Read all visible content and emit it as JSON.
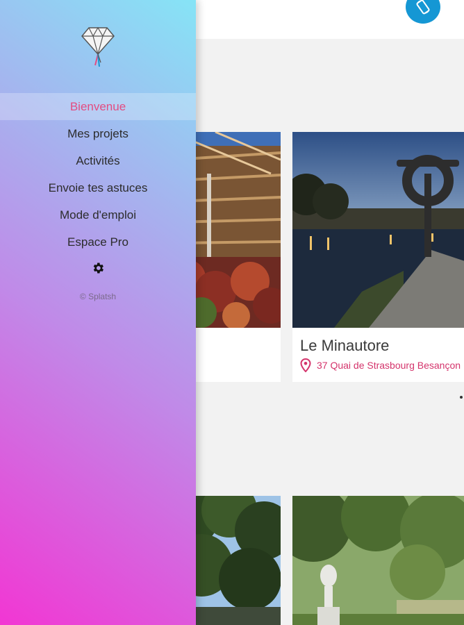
{
  "drawer": {
    "menu": [
      {
        "label": "Bienvenue",
        "active": true
      },
      {
        "label": "Mes projets",
        "active": false
      },
      {
        "label": "Activités",
        "active": false
      },
      {
        "label": "Envoie tes astuces",
        "active": false
      },
      {
        "label": "Mode d'emploi",
        "active": false
      },
      {
        "label": "Espace Pro",
        "active": false
      }
    ],
    "settings_icon": "gear-icon",
    "logo_icon": "diamond-parachute-logo",
    "copyright": "© Splatsh",
    "gradient_colors": [
      "#f236d3",
      "#c08ae8",
      "#86e4f6"
    ],
    "active_color": "#e34c81"
  },
  "main": {
    "fab_icon": "rotate-screen-icon",
    "fab_color": "#1597d4",
    "cards": [
      {
        "photo": "wooden-building-photo"
      },
      {
        "photo": "river-sculpture-photo",
        "title": "Le Minautore",
        "address": "37 Quai de Strasbourg Besançon",
        "address_icon": "map-pin-icon"
      },
      {
        "photo": "trees-photo"
      },
      {
        "photo": "park-urn-photo"
      }
    ]
  }
}
